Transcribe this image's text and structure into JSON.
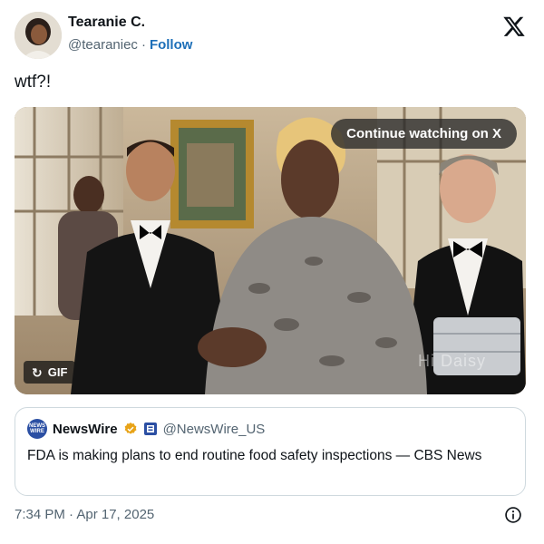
{
  "author": {
    "name": "Tearanie C.",
    "handle": "@tearaniec",
    "separator": "·",
    "follow_label": "Follow"
  },
  "tweet": {
    "text": "wtf?!"
  },
  "media": {
    "continue_label": "Continue watching on X",
    "gif_label": "GIF",
    "watermark": "Hi Daisy"
  },
  "quote": {
    "logo_text": "NEWS WIRE",
    "name": "NewsWire",
    "handle": "@NewsWire_US",
    "text": "FDA is making plans to end routine food safety inspections — CBS News"
  },
  "footer": {
    "timestamp": "7:34 PM · Apr 17, 2025"
  },
  "colors": {
    "link": "#1d6fb8",
    "secondary_text": "#536471",
    "verified": "#e8a317",
    "border": "#cfd9de"
  }
}
